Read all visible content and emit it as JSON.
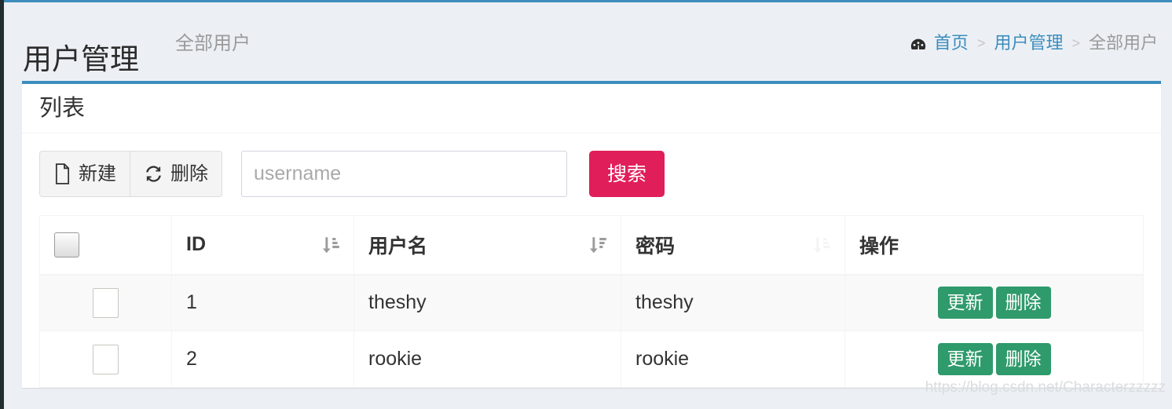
{
  "header": {
    "title": "用户管理",
    "subtitle": "全部用户"
  },
  "breadcrumb": {
    "home_icon": "tachometer-dashboard-icon",
    "items": [
      {
        "label": "首页",
        "current": false
      },
      {
        "label": "用户管理",
        "current": false
      },
      {
        "label": "全部用户",
        "current": true
      }
    ],
    "separator": ">"
  },
  "panel": {
    "title": "列表"
  },
  "toolbar": {
    "new_label": "新建",
    "new_icon": "file-document-icon",
    "delete_label": "删除",
    "delete_icon": "refresh-sync-icon",
    "search_placeholder": "username",
    "search_value": "",
    "search_button_label": "搜索",
    "search_button_color": "#e01e5a"
  },
  "table": {
    "select_all_checked": false,
    "columns": [
      {
        "key": "check",
        "label": "",
        "sortable": false,
        "sort_icon": "",
        "align": "center"
      },
      {
        "key": "id",
        "label": "ID",
        "sortable": true,
        "sort_icon": "sort-amount-down-icon",
        "sort_state": "active",
        "align": "left"
      },
      {
        "key": "user",
        "label": "用户名",
        "sortable": true,
        "sort_icon": "sort-amount-down-alt-icon",
        "sort_state": "active",
        "align": "left"
      },
      {
        "key": "pass",
        "label": "密码",
        "sortable": true,
        "sort_icon": "sort-amount-down-icon",
        "sort_state": "inactive",
        "align": "left"
      },
      {
        "key": "ops",
        "label": "操作",
        "sortable": false,
        "sort_icon": "",
        "align": "center"
      }
    ],
    "rows": [
      {
        "checked": false,
        "id": "1",
        "username": "theshy",
        "password": "theshy",
        "update_label": "更新",
        "delete_label": "删除"
      },
      {
        "checked": false,
        "id": "2",
        "username": "rookie",
        "password": "rookie",
        "update_label": "更新",
        "delete_label": "删除"
      }
    ],
    "row_button_color": "#2f9a6b"
  },
  "watermark": {
    "text": "https://blog.csdn.net/Characterzzzzz"
  }
}
